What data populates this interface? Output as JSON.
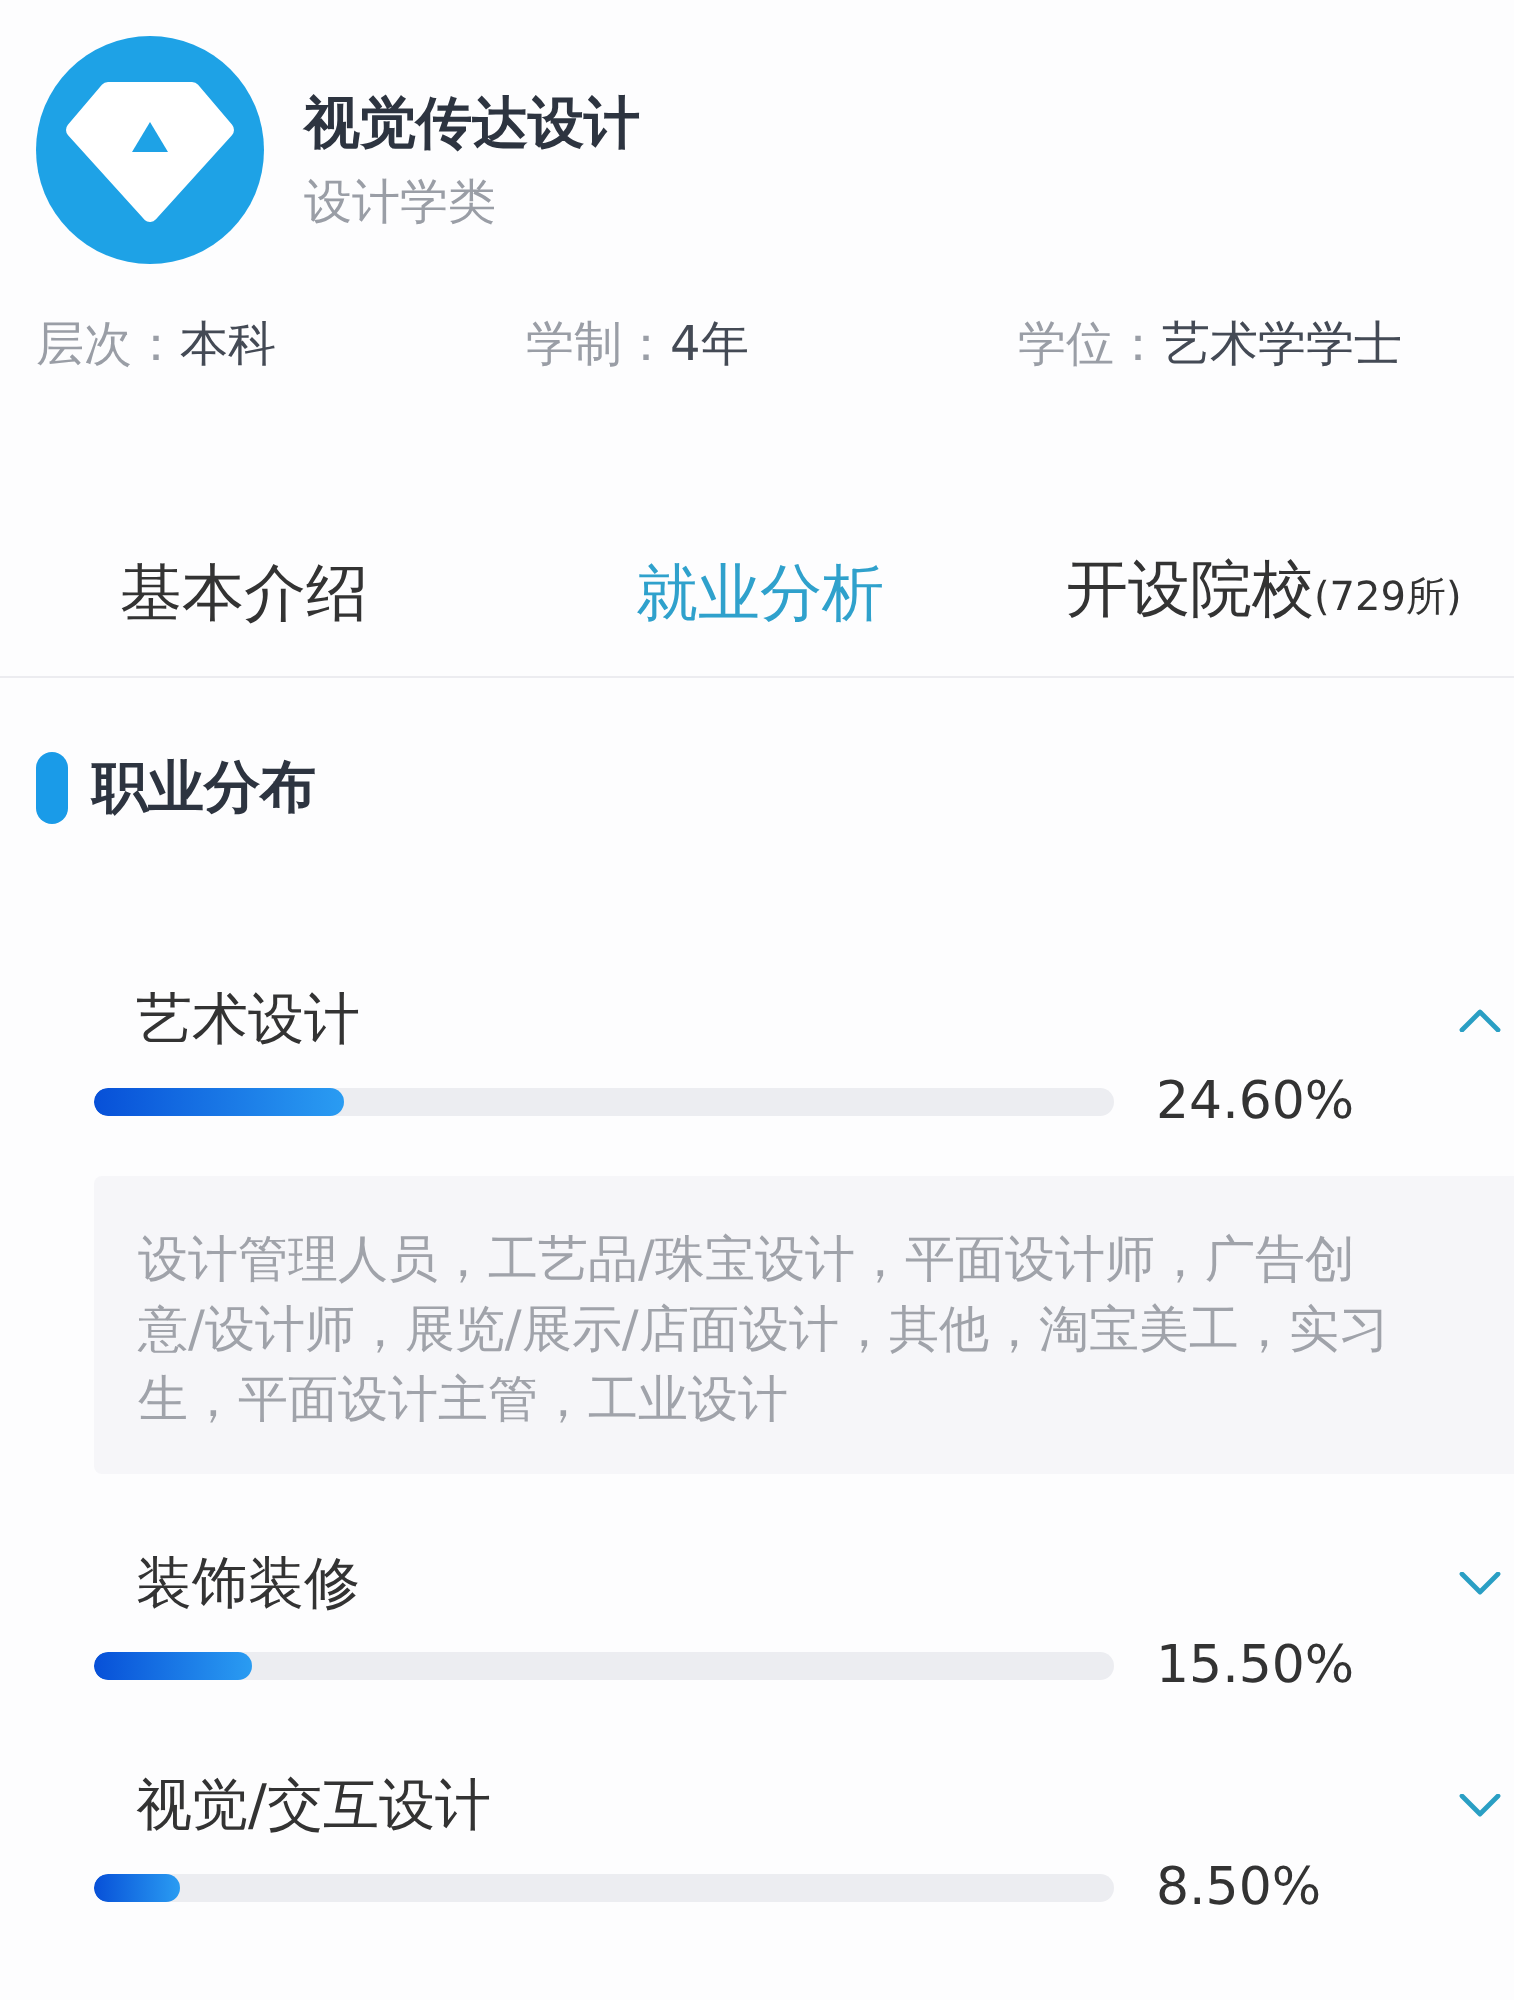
{
  "header": {
    "title": "视觉传达设计",
    "category": "设计学类"
  },
  "info": [
    {
      "label": "层次：",
      "value": "本科"
    },
    {
      "label": "学制：",
      "value": "4年"
    },
    {
      "label": "学位：",
      "value": "艺术学学士"
    }
  ],
  "tabs": [
    {
      "label": "基本介绍",
      "selected": false
    },
    {
      "label": "就业分析",
      "selected": true
    },
    {
      "label": "开设院校",
      "count": "(729所)",
      "selected": false
    }
  ],
  "section": {
    "title": "职业分布"
  },
  "occupations": [
    {
      "name": "艺术设计",
      "level": 0.246,
      "percent": "24.60%",
      "expanded": true,
      "detail": "设计管理人员，工艺品/珠宝设计，平面设计师，广告创意/设计师，展览/展示/店面设计，其他，淘宝美工，实习生，平面设计主管，工业设计"
    },
    {
      "name": "装饰装修",
      "level": 0.155,
      "percent": "15.50%",
      "expanded": false
    },
    {
      "name": "视觉/交互设计",
      "level": 0.085,
      "percent": "8.50%",
      "expanded": false
    }
  ]
}
